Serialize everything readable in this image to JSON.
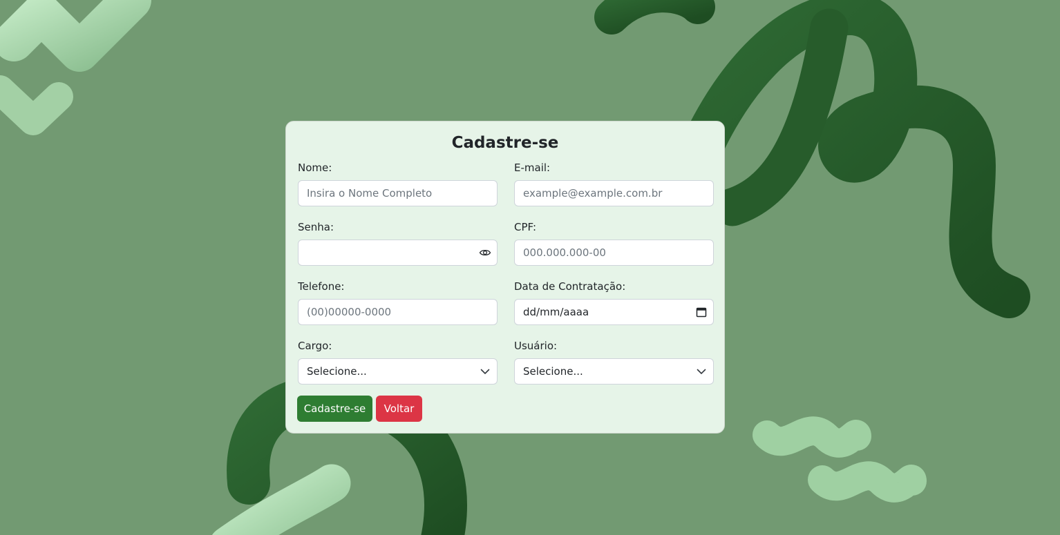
{
  "colors": {
    "background": "#729a72",
    "card": "#e6f4e8",
    "primary": "#2e7d32",
    "danger": "#dc3545"
  },
  "form": {
    "title": "Cadastre-se",
    "fields": {
      "nome": {
        "label": "Nome:",
        "placeholder": "Insira o Nome Completo"
      },
      "email": {
        "label": "E-mail:",
        "placeholder": "example@example.com.br"
      },
      "senha": {
        "label": "Senha:",
        "value": "",
        "toggle_icon": "eye-icon"
      },
      "cpf": {
        "label": "CPF:",
        "placeholder": "000.000.000-00"
      },
      "telefone": {
        "label": "Telefone:",
        "placeholder": "(00)00000-0000"
      },
      "data_contratacao": {
        "label": "Data de Contratação:",
        "value": "dd/mm/aaaa",
        "icon": "calendar-icon"
      },
      "cargo": {
        "label": "Cargo:",
        "selected": "Selecione...",
        "icon": "chevron-down-icon"
      },
      "usuario": {
        "label": "Usuário:",
        "selected": "Selecione...",
        "icon": "chevron-down-icon"
      }
    },
    "buttons": {
      "submit": "Cadastre-se",
      "back": "Voltar"
    }
  }
}
